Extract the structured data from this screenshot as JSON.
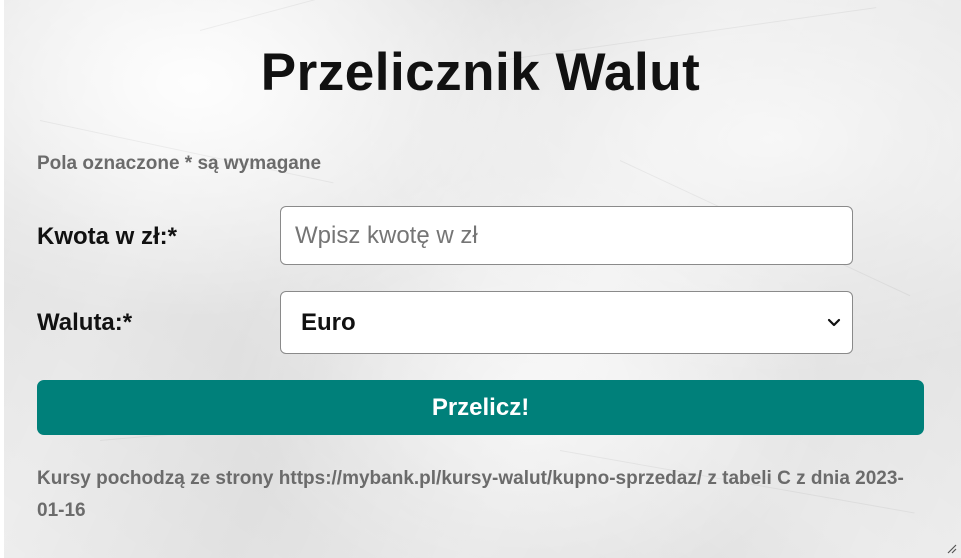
{
  "title": "Przelicznik Walut",
  "required_note": "Pola oznaczone * są wymagane",
  "form": {
    "amount_label": "Kwota w zł:*",
    "amount_placeholder": "Wpisz kwotę w zł",
    "amount_value": "",
    "currency_label": "Waluta:*",
    "currency_selected": "Euro",
    "submit_label": "Przelicz!"
  },
  "footer_note": "Kursy pochodzą ze strony https://mybank.pl/kursy-walut/kupno-sprzedaz/ z tabeli C z dnia 2023-01-16",
  "colors": {
    "accent": "#00807a",
    "muted_text": "#6b6b6b",
    "heading_text": "#111111"
  },
  "icons": {
    "select_arrow": "chevron-down-icon",
    "resize_handle": "resize-handle-icon"
  }
}
